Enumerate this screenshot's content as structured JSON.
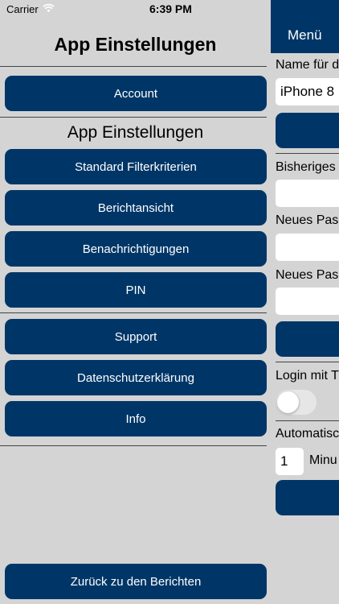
{
  "status_bar": {
    "carrier": "Carrier",
    "time": "6:39 PM"
  },
  "page": {
    "title": "App Einstellungen",
    "section_title": "App Einstellungen"
  },
  "buttons": {
    "account": "Account",
    "filter": "Standard Filterkriterien",
    "report_view": "Berichtansicht",
    "notifications": "Benachrichtigungen",
    "pin": "PIN",
    "support": "Support",
    "privacy": "Datenschutzerklärung",
    "info": "Info",
    "back": "Zurück zu den Berichten"
  },
  "menu": {
    "title": "Menü",
    "name_label": "Name für d",
    "name_value": "iPhone 8",
    "old_password_label": "Bisheriges",
    "new_password_label": "Neues Pas",
    "new_password_repeat_label": "Neues Pas",
    "login_label": "Login mit T",
    "login_toggle_on": false,
    "auto_label": "Automatisc",
    "minutes_value": "1",
    "minutes_label": "Minu"
  },
  "colors": {
    "button": "#003667",
    "background": "#d4d4d4"
  }
}
